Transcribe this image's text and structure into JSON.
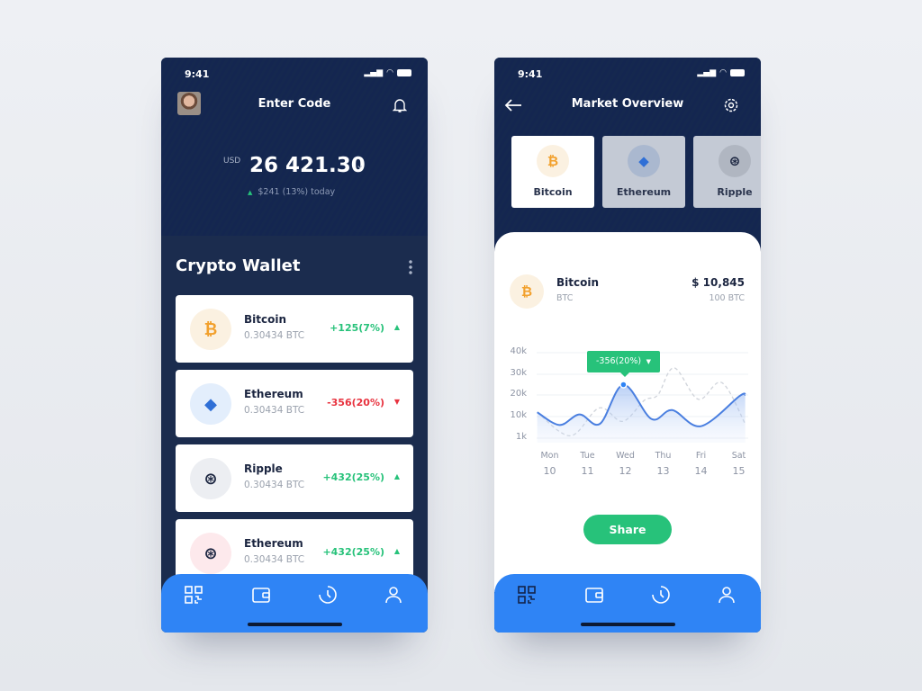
{
  "status_time": "9:41",
  "wallet": {
    "title": "Enter Code",
    "currency": "USD",
    "balance": "26 421.30",
    "today_change": "$241 (13%) today",
    "section_title": "Crypto Wallet",
    "items": [
      {
        "name": "Bitcoin",
        "amount": "0.30434 BTC",
        "change": "+125(7%)",
        "direction": "up",
        "icon": "bitcoin-icon"
      },
      {
        "name": "Ethereum",
        "amount": "0.30434 BTC",
        "change": "-356(20%)",
        "direction": "down",
        "icon": "ethereum-icon"
      },
      {
        "name": "Ripple",
        "amount": "0.30434 BTC",
        "change": "+432(25%)",
        "direction": "up",
        "icon": "ripple-icon"
      },
      {
        "name": "Ethereum",
        "amount": "0.30434 BTC",
        "change": "+432(25%)",
        "direction": "up",
        "icon": "ripple-icon"
      }
    ]
  },
  "market": {
    "title": "Market Overview",
    "tabs": [
      {
        "label": "Bitcoin",
        "selected": true
      },
      {
        "label": "Ethereum",
        "selected": false
      },
      {
        "label": "Ripple",
        "selected": false
      }
    ],
    "coin_name": "Bitcoin",
    "coin_symbol": "BTC",
    "price": "$ 10,845",
    "holding": "100 BTC",
    "tooltip": "-356(20%)",
    "share_label": "Share",
    "chart": {
      "type": "line",
      "y_ticks": [
        "40k",
        "30k",
        "20k",
        "10k",
        "1k"
      ],
      "y_tick_values": [
        40000,
        30000,
        20000,
        10000,
        1000
      ],
      "x_days": [
        "Mon",
        "Tue",
        "Wed",
        "Thu",
        "Fri",
        "Sat"
      ],
      "x_dates": [
        "10",
        "11",
        "12",
        "13",
        "14",
        "15"
      ],
      "series": [
        {
          "style": "solid",
          "x": [
            -0.33,
            0.26,
            0.79,
            1.33,
            1.95,
            2.69,
            3.24,
            4.0,
            5.02,
            5.17
          ],
          "values": [
            12000,
            6500,
            11000,
            7000,
            25000,
            9000,
            13000,
            6000,
            19500,
            20000
          ]
        },
        {
          "style": "dashed",
          "x": [
            -0.33,
            0.55,
            1.31,
            1.93,
            2.5,
            2.86,
            3.29,
            3.93,
            4.55,
            5.17
          ],
          "values": [
            12000,
            2000,
            14000,
            8000,
            17500,
            20000,
            33000,
            18000,
            26000,
            7000
          ]
        }
      ],
      "highlight": {
        "x": 1.95,
        "value": 25000
      }
    }
  },
  "colors": {
    "navy": "#142650",
    "blue": "#2f84f5",
    "green": "#27c27a",
    "red": "#e8333f",
    "line": "#4a7fe0"
  }
}
